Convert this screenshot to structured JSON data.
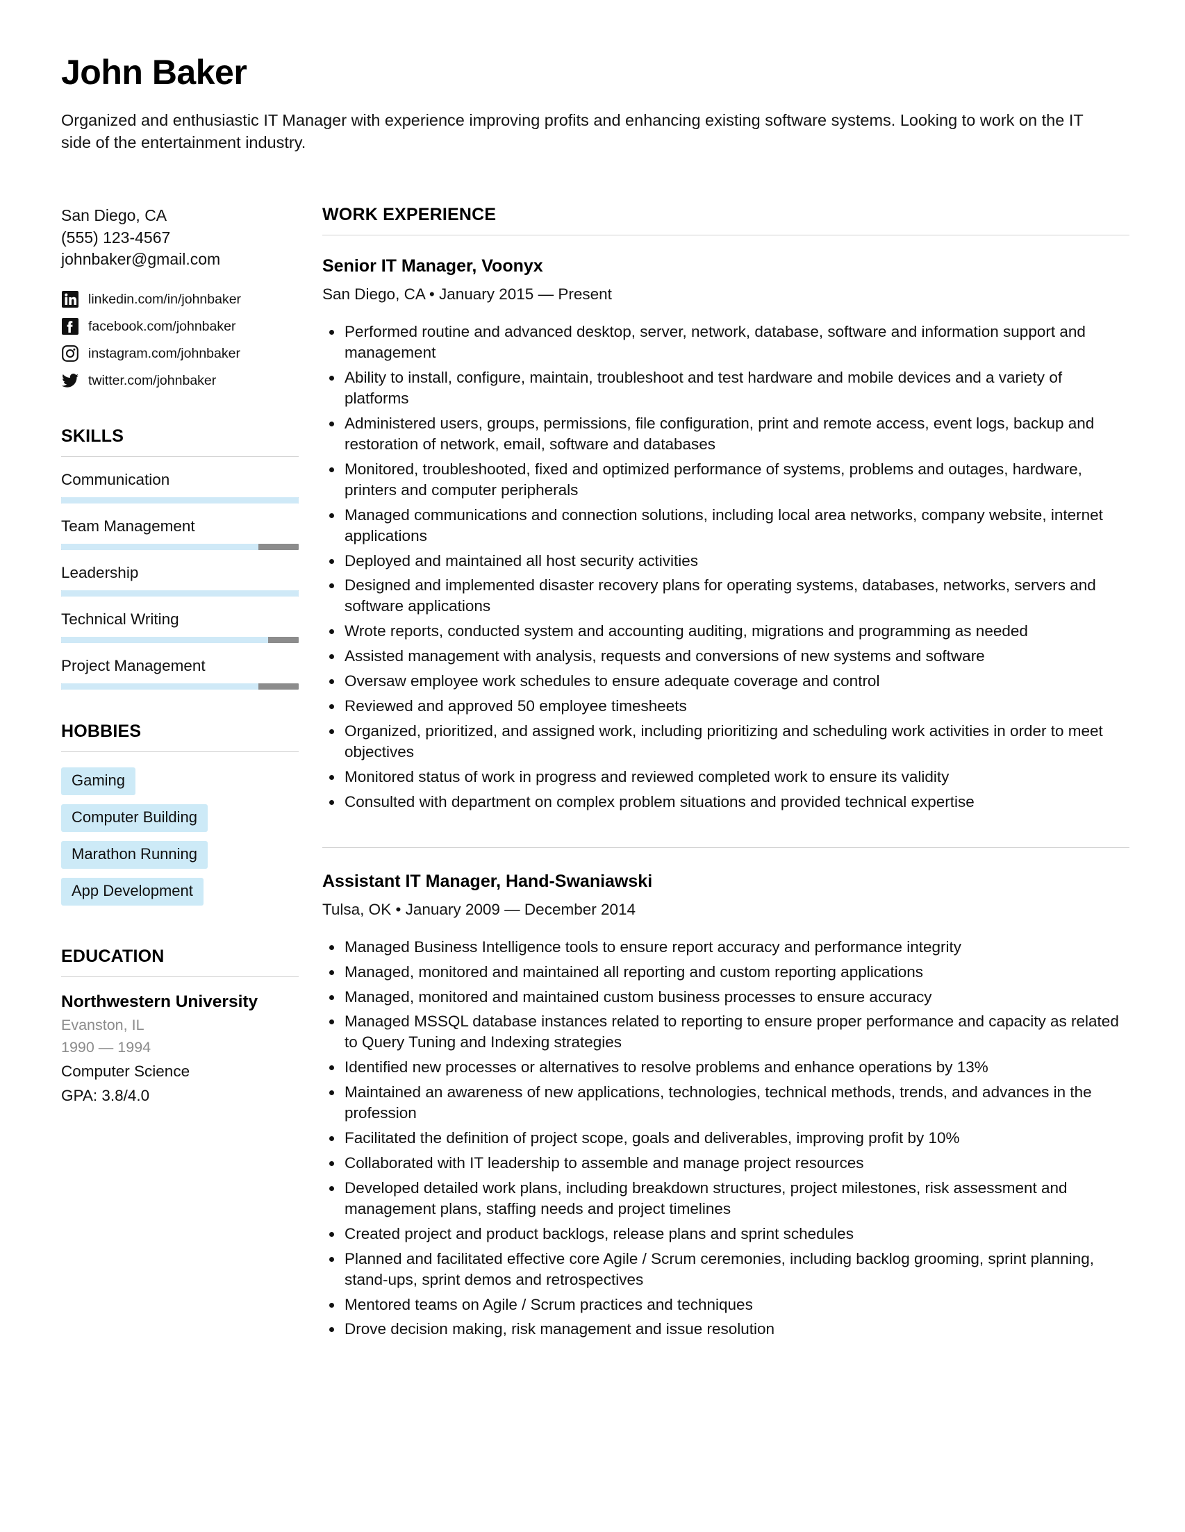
{
  "header": {
    "name": "John Baker",
    "summary": "Organized and enthusiastic IT Manager with experience improving profits and enhancing existing software systems. Looking to work on the IT side of the entertainment industry."
  },
  "contact": {
    "location": "San Diego, CA",
    "phone": "(555) 123-4567",
    "email": "johnbaker@gmail.com",
    "socials": [
      {
        "icon": "linkedin-icon",
        "text": "linkedin.com/in/johnbaker"
      },
      {
        "icon": "facebook-icon",
        "text": "facebook.com/johnbaker"
      },
      {
        "icon": "instagram-icon",
        "text": "instagram.com/johnbaker"
      },
      {
        "icon": "twitter-icon",
        "text": "twitter.com/johnbaker"
      }
    ]
  },
  "skills": {
    "title": "SKILLS",
    "items": [
      {
        "label": "Communication",
        "level": 100
      },
      {
        "label": "Team Management",
        "level": 83
      },
      {
        "label": "Leadership",
        "level": 100
      },
      {
        "label": "Technical Writing",
        "level": 87
      },
      {
        "label": "Project Management",
        "level": 83
      }
    ]
  },
  "hobbies": {
    "title": "HOBBIES",
    "items": [
      "Gaming",
      "Computer Building",
      "Marathon Running",
      "App Development"
    ]
  },
  "education": {
    "title": "EDUCATION",
    "school": "Northwestern University",
    "location": "Evanston, IL",
    "years": "1990 — 1994",
    "major": "Computer Science",
    "gpa": "GPA: 3.8/4.0"
  },
  "work": {
    "title": "WORK EXPERIENCE",
    "jobs": [
      {
        "title": "Senior IT Manager, Voonyx",
        "meta": "San Diego, CA • January 2015 — Present",
        "bullets": [
          "Performed routine and advanced desktop, server, network, database, software and information support and management",
          "Ability to install, configure, maintain, troubleshoot and test hardware and mobile devices and a variety of platforms",
          "Administered users, groups, permissions, file configuration, print and remote access, event logs, backup and restoration of network, email, software and databases",
          "Monitored, troubleshooted, fixed and optimized performance of systems, problems and outages, hardware, printers and computer peripherals",
          "Managed communications and connection solutions, including local area networks, company website, internet applications",
          "Deployed and maintained all host security activities",
          "Designed and implemented disaster recovery plans for operating systems, databases, networks, servers and software applications",
          "Wrote reports, conducted system and accounting auditing, migrations and programming as needed",
          "Assisted management with analysis, requests and conversions of new systems and software",
          "Oversaw employee work schedules to ensure adequate coverage and control",
          "Reviewed and approved 50 employee timesheets",
          "Organized, prioritized, and assigned work, including prioritizing and scheduling work activities in order to meet objectives",
          "Monitored status of work in progress and reviewed completed work to ensure its validity",
          "Consulted with department on complex problem situations and provided technical expertise"
        ]
      },
      {
        "title": "Assistant IT Manager, Hand-Swaniawski",
        "meta": "Tulsa, OK • January 2009 — December 2014",
        "bullets": [
          "Managed Business Intelligence tools to ensure report accuracy and performance integrity",
          "Managed, monitored and maintained all reporting and custom reporting applications",
          "Managed, monitored and maintained custom business processes to ensure accuracy",
          "Managed MSSQL database instances related to reporting to ensure proper performance and capacity as related to Query Tuning and Indexing strategies",
          "Identified new processes or alternatives to resolve problems and enhance operations by 13%",
          "Maintained an awareness of new applications, technologies, technical methods, trends, and advances in the profession",
          "Facilitated the definition of project scope, goals and deliverables, improving profit by 10%",
          "Collaborated with IT leadership to assemble and manage project resources",
          "Developed detailed work plans, including breakdown structures, project milestones, risk assessment and management plans, staffing needs and project timelines",
          "Created project and product backlogs, release plans and sprint schedules",
          "Planned and facilitated effective core Agile / Scrum ceremonies, including backlog grooming, sprint planning, stand-ups, sprint demos and retrospectives",
          "Mentored teams on Agile / Scrum practices and techniques",
          "Drove decision making, risk management and issue resolution"
        ]
      }
    ]
  },
  "colors": {
    "accent": "#cdeaf7",
    "track": "#8c8c8c",
    "rule": "#d2d2d2",
    "muted": "#8c8c8c"
  }
}
